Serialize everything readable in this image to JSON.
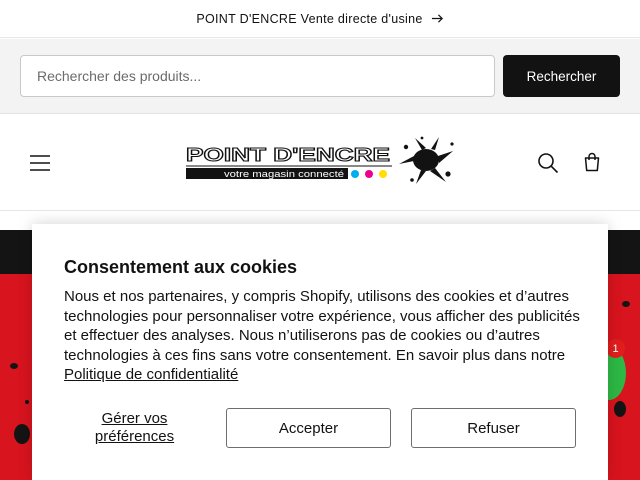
{
  "announcement": {
    "text": "POINT D'ENCRE Vente directe d'usine",
    "arrow_icon": "arrow-right-icon"
  },
  "search": {
    "placeholder": "Rechercher des produits...",
    "value": "",
    "button_label": "Rechercher"
  },
  "header": {
    "menu_icon": "hamburger-menu-icon",
    "logo": {
      "name": "POINT D'ENCRE",
      "tagline": "votre magasin connecté"
    },
    "search_icon": "search-icon",
    "cart_icon": "cart-icon"
  },
  "chat": {
    "badge_count": "1"
  },
  "cookie_banner": {
    "title": "Consentement aux cookies",
    "body": "Nous et nos partenaires, y compris Shopify, utilisons des cookies et d’autres technologies pour personnaliser votre expérience, vous afficher des publicités et effectuer des analyses. Nous n’utiliserons pas de cookies ou d’autres technologies à ces fins sans votre consentement. En savoir plus dans notre",
    "privacy_link": "Politique de confidentialité",
    "preferences_label": "Gérer vos préférences",
    "accept_label": "Accepter",
    "refuse_label": "Refuser"
  },
  "colors": {
    "hero_red": "#d8141e",
    "hero_dark": "#141414",
    "button_dark": "#121212",
    "chat_green": "#2eb845",
    "badge_red": "#e11d1d",
    "logo_cyan": "#00aeef",
    "logo_magenta": "#ec008c",
    "logo_yellow": "#ffde00"
  }
}
